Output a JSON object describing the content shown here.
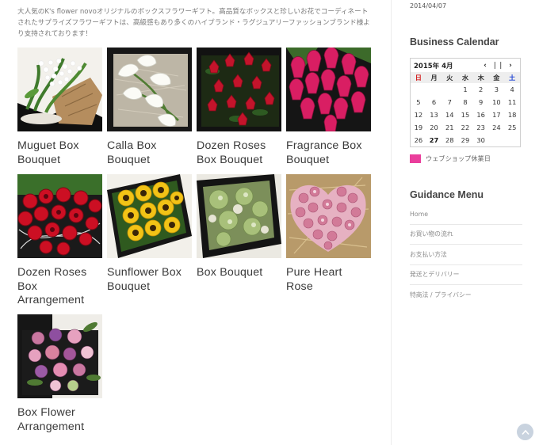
{
  "intro": "大人気のK's flower novoオリジナルのボックスフラワーギフト。高品質なボックスと珍しいお花でコーディネートされたサプライズフラワーギフトは、高級感もあり多くのハイブランド・ラグジュアリーファッションブランド様より支持されております！",
  "products": [
    {
      "title": "Muguet Box Bouquet",
      "image": "lily-of-the-valley-bouquet"
    },
    {
      "title": "Calla Box Bouquet",
      "image": "white-calla-lilies-box"
    },
    {
      "title": "Dozen Roses Box Bouquet",
      "image": "red-roses-black-box"
    },
    {
      "title": "Fragrance Box Bouquet",
      "image": "pink-tulips-box"
    },
    {
      "title": "Dozen Roses Box Arrangement",
      "image": "red-roses-arrangement"
    },
    {
      "title": "Sunflower Box Bouquet",
      "image": "sunflowers-box"
    },
    {
      "title": "Box Bouquet",
      "image": "green-hydrangea-box"
    },
    {
      "title": "Pure Heart Rose",
      "image": "pink-heart-roses"
    },
    {
      "title": "Box Flower Arrangement",
      "image": "mixed-pink-purple-box"
    }
  ],
  "sidebar": {
    "date": "2014/04/07",
    "calendar_title": "Business Calendar",
    "calendar": {
      "month_label": "2015年 4月",
      "prev_icon": "chevron-left-icon",
      "pause_icon": "pause-icon",
      "next_icon": "chevron-right-icon",
      "weekdays": [
        "日",
        "月",
        "火",
        "水",
        "木",
        "金",
        "土"
      ],
      "weeks": [
        [
          "",
          "",
          "",
          "1",
          "2",
          "3",
          "4"
        ],
        [
          "5",
          "6",
          "7",
          "8",
          "9",
          "10",
          "11"
        ],
        [
          "12",
          "13",
          "14",
          "15",
          "16",
          "17",
          "18"
        ],
        [
          "19",
          "20",
          "21",
          "22",
          "23",
          "24",
          "25"
        ],
        [
          "26",
          "27",
          "28",
          "29",
          "30",
          "",
          ""
        ]
      ],
      "today": "27",
      "colors": {
        "sunday": "#d31a1a",
        "saturday": "#1a3fd3",
        "holiday": "#ea3e9c"
      }
    },
    "legend_label": "ウェブショップ休業日",
    "guidance_title": "Guidance Menu",
    "guidance_items": [
      "Home",
      "お買い物の流れ",
      "お支払い方法",
      "発送とデリバリー",
      "特商法 / プライバシー"
    ]
  },
  "back_to_top_icon": "arrow-up-icon"
}
